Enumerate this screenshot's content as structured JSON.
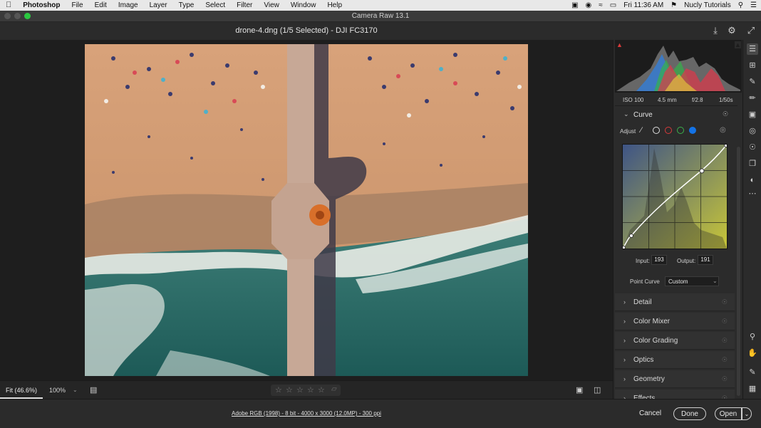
{
  "menubar": {
    "app": "Photoshop",
    "items": [
      "File",
      "Edit",
      "Image",
      "Layer",
      "Type",
      "Select",
      "Filter",
      "View",
      "Window",
      "Help"
    ],
    "clock": "Fri 11:36 AM",
    "user": "Nucly Tutorials"
  },
  "window": {
    "title": "Camera Raw 13.1"
  },
  "header": {
    "file_title": "drone-4.dng (1/5 Selected)  -  DJI FC3170"
  },
  "histogram": {
    "iso": "ISO 100",
    "focal": "4.5 mm",
    "aperture": "f/2.8",
    "shutter": "1/50s"
  },
  "curve": {
    "title": "Curve",
    "adjust_label": "Adjust",
    "input_label": "Input:",
    "input_value": "193",
    "output_label": "Output:",
    "output_value": "191",
    "point_curve_label": "Point Curve",
    "point_curve_value": "Custom"
  },
  "sections": [
    "Detail",
    "Color Mixer",
    "Color Grading",
    "Optics",
    "Geometry",
    "Effects"
  ],
  "bottom": {
    "zoom_fit": "Fit (46.6%)",
    "zoom_100": "100%"
  },
  "footer": {
    "info": "Adobe RGB (1998) - 8 bit - 4000 x 3000 (12.0MP) - 300 ppi",
    "cancel": "Cancel",
    "done": "Done",
    "open": "Open"
  },
  "colors": {
    "accent": "#1473e6",
    "panel": "#2b2b2b",
    "canvas": "#1e1e1e"
  }
}
